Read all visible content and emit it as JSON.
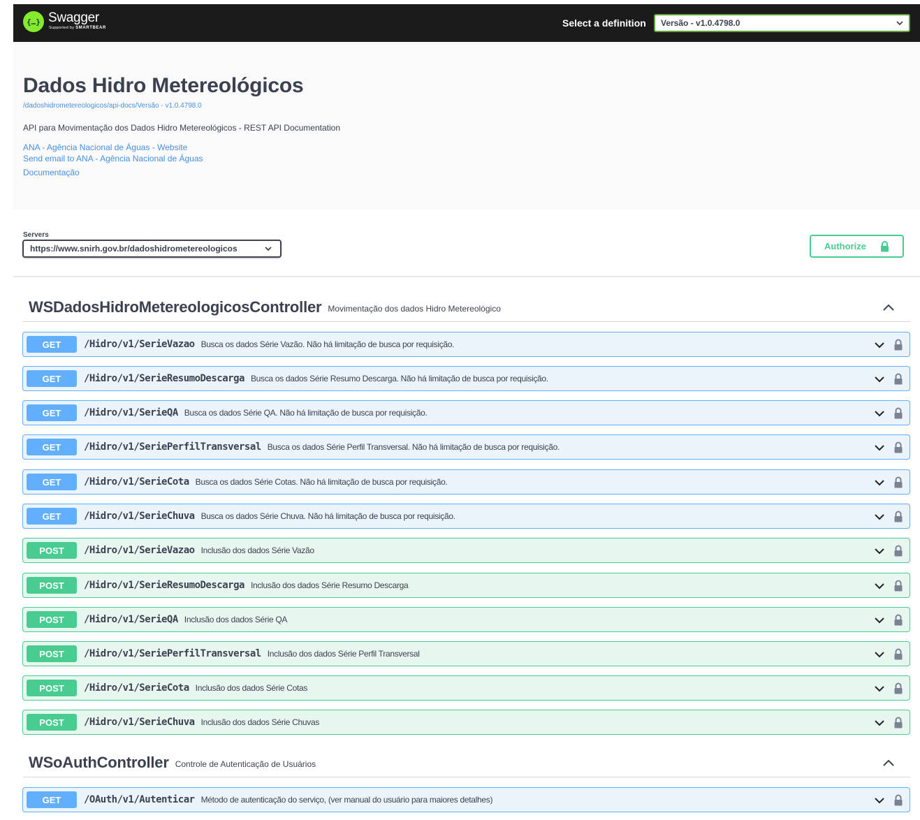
{
  "topbar": {
    "logo_name": "Swagger",
    "logo_sub_prefix": "Supported by",
    "logo_sub_brand": "SMARTBEAR",
    "definition_label": "Select a definition",
    "definition_value": "Versão - v1.0.4798.0"
  },
  "info": {
    "title": "Dados Hidro Metereológicos",
    "base_url": "/dadoshidrometereologicos/api-docs/Versão - v1.0.4798.0",
    "description": "API para Movimentação dos Dados Hidro Metereológicos - REST API Documentation",
    "links": [
      "ANA - Agência Nacional de Águas - Website",
      "Send email to ANA - Agência Nacional de Águas",
      "Documentação"
    ]
  },
  "servers": {
    "label": "Servers",
    "value": "https://www.snirh.gov.br/dadoshidrometereologicos"
  },
  "authorize_label": "Authorize",
  "tags": [
    {
      "name": "WSDadosHidroMetereologicosController",
      "description": "Movimentação dos dados Hidro Metereológico",
      "operations": [
        {
          "method": "GET",
          "path": "/Hidro/v1/SerieVazao",
          "summary": "Busca os dados Série Vazão. Não há limitação de busca por requisição."
        },
        {
          "method": "GET",
          "path": "/Hidro/v1/SerieResumoDescarga",
          "summary": "Busca os dados Série Resumo Descarga. Não há limitação de busca por requisição."
        },
        {
          "method": "GET",
          "path": "/Hidro/v1/SerieQA",
          "summary": "Busca os dados Série QA. Não há limitação de busca por requisição."
        },
        {
          "method": "GET",
          "path": "/Hidro/v1/SeriePerfilTransversal",
          "summary": "Busca os dados Série Perfil Transversal. Não há limitação de busca por requisição."
        },
        {
          "method": "GET",
          "path": "/Hidro/v1/SerieCota",
          "summary": "Busca os dados Série Cotas. Não há limitação de busca por requisição."
        },
        {
          "method": "GET",
          "path": "/Hidro/v1/SerieChuva",
          "summary": "Busca os dados Série Chuva. Não há limitação de busca por requisição."
        },
        {
          "method": "POST",
          "path": "/Hidro/v1/SerieVazao",
          "summary": "Inclusão dos dados Série Vazão"
        },
        {
          "method": "POST",
          "path": "/Hidro/v1/SerieResumoDescarga",
          "summary": "Inclusão dos dados Série Resumo Descarga"
        },
        {
          "method": "POST",
          "path": "/Hidro/v1/SerieQA",
          "summary": "Inclusão dos dados Série QA"
        },
        {
          "method": "POST",
          "path": "/Hidro/v1/SeriePerfilTransversal",
          "summary": "Inclusão dos dados Série Perfil Transversal"
        },
        {
          "method": "POST",
          "path": "/Hidro/v1/SerieCota",
          "summary": "Inclusão dos dados Série Cotas"
        },
        {
          "method": "POST",
          "path": "/Hidro/v1/SerieChuva",
          "summary": "Inclusão dos dados Série Chuvas"
        }
      ]
    },
    {
      "name": "WSoAuthController",
      "description": "Controle de Autenticação de Usuários",
      "operations": [
        {
          "method": "GET",
          "path": "/OAuth/v1/Autenticar",
          "summary": "Método de autenticação do serviço, (ver manual do usuário para maiores detalhes)"
        }
      ]
    }
  ],
  "colors": {
    "get": "#61affe",
    "post": "#49cc90",
    "topbar": "#1b1b1b",
    "link": "#4990e2"
  },
  "icons": [
    "swagger-logo-icon",
    "chevron-down-icon",
    "chevron-up-icon",
    "lock-icon"
  ]
}
